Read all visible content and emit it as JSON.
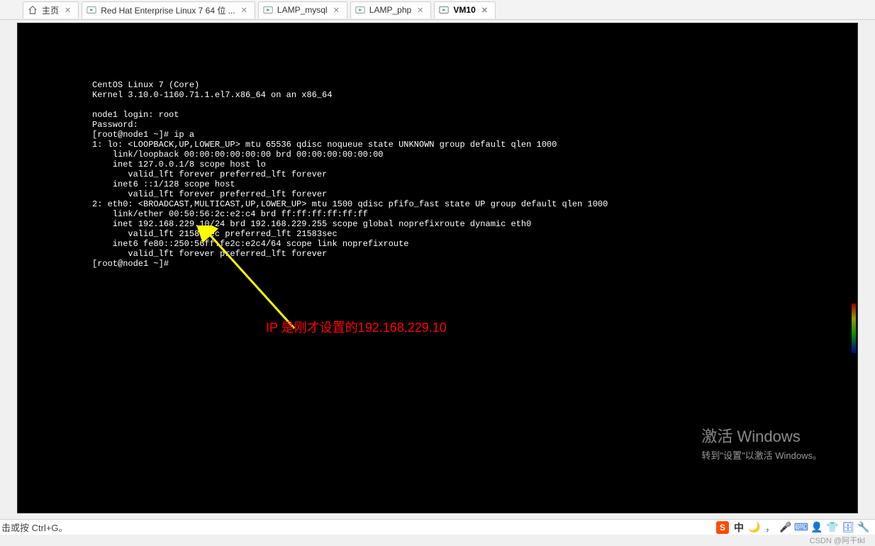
{
  "tabs": {
    "home": "主页",
    "rhel": "Red Hat Enterprise Linux 7 64 位 ...",
    "mysql": "LAMP_mysql",
    "php": "LAMP_php",
    "vm10": "VM10"
  },
  "terminal": {
    "line01": "CentOS Linux 7 (Core)",
    "line02": "Kernel 3.10.0-1160.71.1.el7.x86_64 on an x86_64",
    "line03": "",
    "line04": "node1 login: root",
    "line05": "Password:",
    "line06": "[root@node1 ~]# ip a",
    "line07": "1: lo: <LOOPBACK,UP,LOWER_UP> mtu 65536 qdisc noqueue state UNKNOWN group default qlen 1000",
    "line08": "    link/loopback 00:00:00:00:00:00 brd 00:00:00:00:00:00",
    "line09": "    inet 127.0.0.1/8 scope host lo",
    "line10": "       valid_lft forever preferred_lft forever",
    "line11": "    inet6 ::1/128 scope host",
    "line12": "       valid_lft forever preferred_lft forever",
    "line13": "2: eth0: <BROADCAST,MULTICAST,UP,LOWER_UP> mtu 1500 qdisc pfifo_fast state UP group default qlen 1000",
    "line14": "    link/ether 00:50:56:2c:e2:c4 brd ff:ff:ff:ff:ff:ff",
    "line15": "    inet 192.168.229.10/24 brd 192.168.229.255 scope global noprefixroute dynamic eth0",
    "line16": "       valid_lft 21583sec preferred_lft 21583sec",
    "line17": "    inet6 fe80::250:56ff:fe2c:e2c4/64 scope link noprefixroute",
    "line18": "       valid_lft forever preferred_lft forever",
    "line19": "[root@node1 ~]#"
  },
  "annotation": "IP 是刚才设置的192.168.229.10",
  "watermark": {
    "title": "激活 Windows",
    "subtitle": "转到\"设置\"以激活 Windows。"
  },
  "status_hint": "击或按 Ctrl+G。",
  "ime": {
    "zh": "中"
  },
  "csdn": "CSDN @阿干tkl"
}
